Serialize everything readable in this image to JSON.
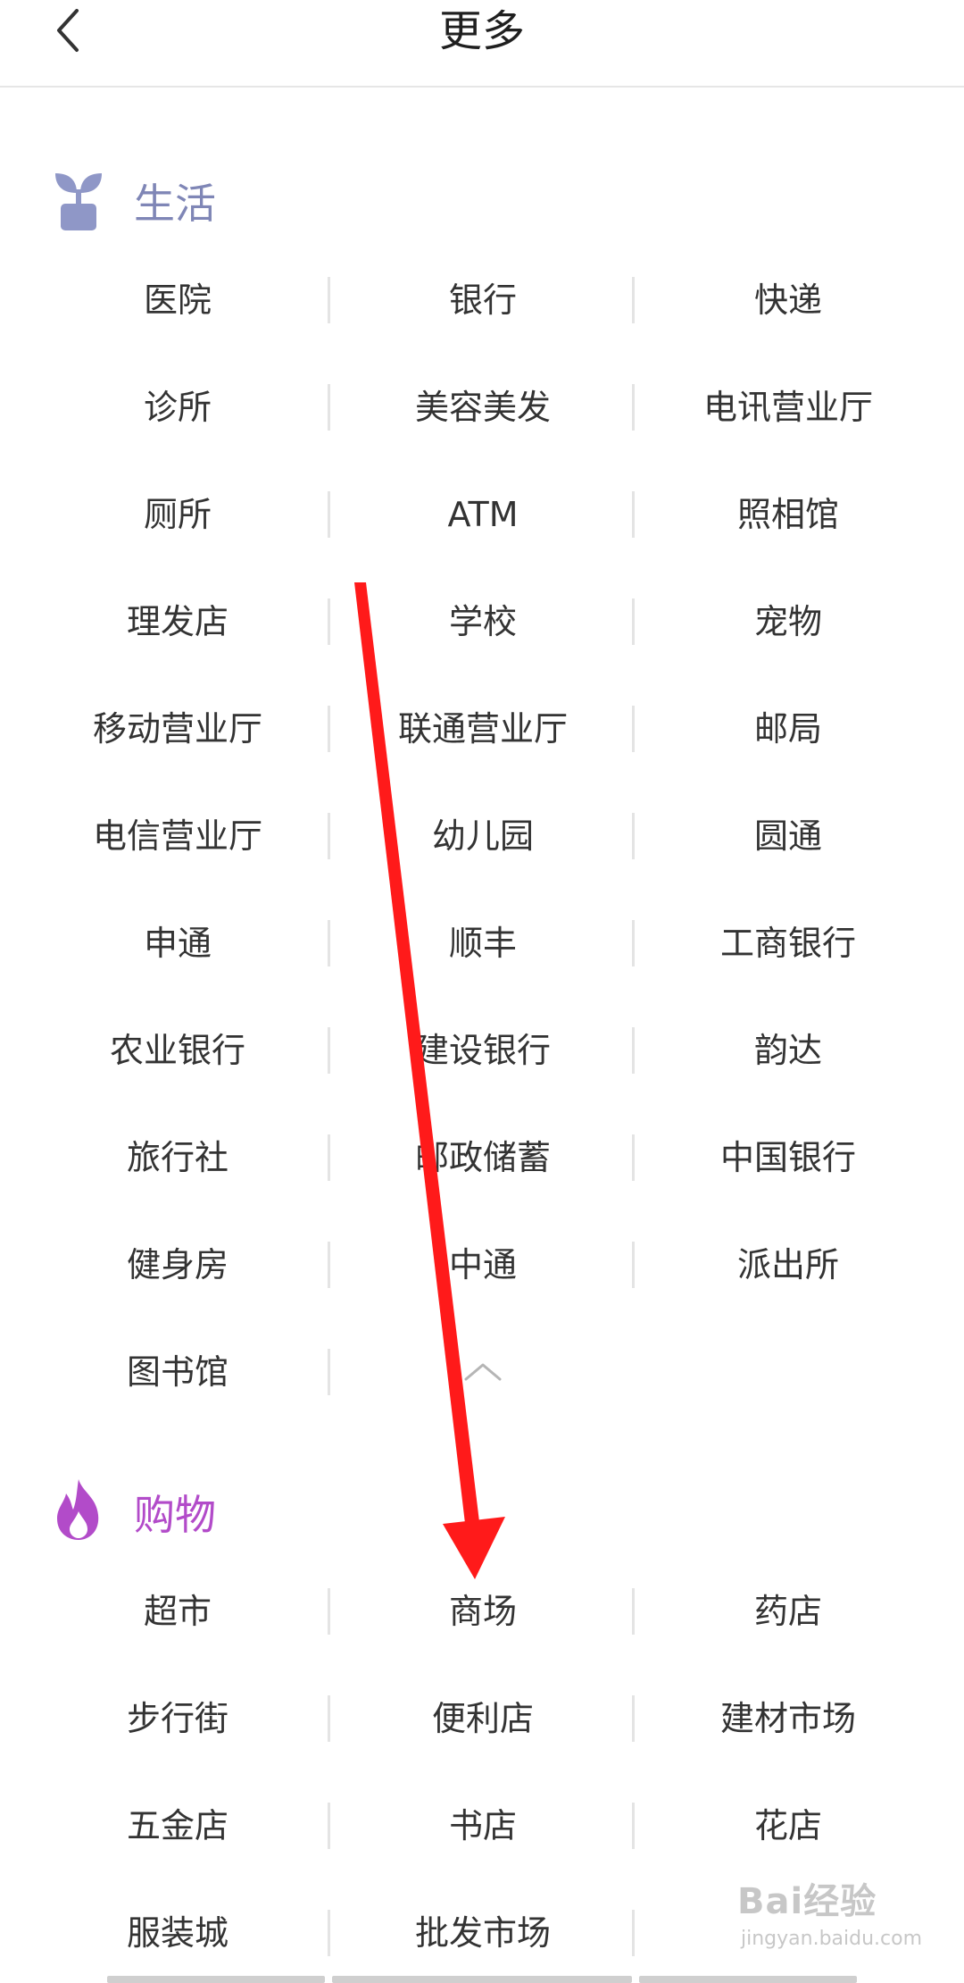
{
  "header": {
    "title": "更多"
  },
  "sections": {
    "life": {
      "title": "生活",
      "rows": [
        [
          "医院",
          "银行",
          "快递"
        ],
        [
          "诊所",
          "美容美发",
          "电讯营业厅"
        ],
        [
          "厕所",
          "ATM",
          "照相馆"
        ],
        [
          "理发店",
          "学校",
          "宠物"
        ],
        [
          "移动营业厅",
          "联通营业厅",
          "邮局"
        ],
        [
          "电信营业厅",
          "幼儿园",
          "圆通"
        ],
        [
          "申通",
          "顺丰",
          "工商银行"
        ],
        [
          "农业银行",
          "建设银行",
          "韵达"
        ],
        [
          "旅行社",
          "邮政储蓄",
          "中国银行"
        ],
        [
          "健身房",
          "中通",
          "派出所"
        ],
        [
          "图书馆",
          "",
          ""
        ]
      ]
    },
    "shop": {
      "title": "购物",
      "rows": [
        [
          "超市",
          "商场",
          "药店"
        ],
        [
          "步行街",
          "便利店",
          "建材市场"
        ],
        [
          "五金店",
          "书店",
          "花店"
        ],
        [
          "服装城",
          "批发市场",
          ""
        ]
      ]
    }
  },
  "icons": {
    "back": "chevron-left-icon",
    "life": "sprout-icon",
    "shop": "flame-icon",
    "collapse": "chevron-up-icon"
  },
  "colors": {
    "life_accent": "#7f86b6",
    "shop_accent": "#b24bc9",
    "annotation_arrow": "#ff1a1a"
  },
  "watermark": {
    "brand": "Bai经验",
    "url": "jingyan.baidu.com"
  }
}
